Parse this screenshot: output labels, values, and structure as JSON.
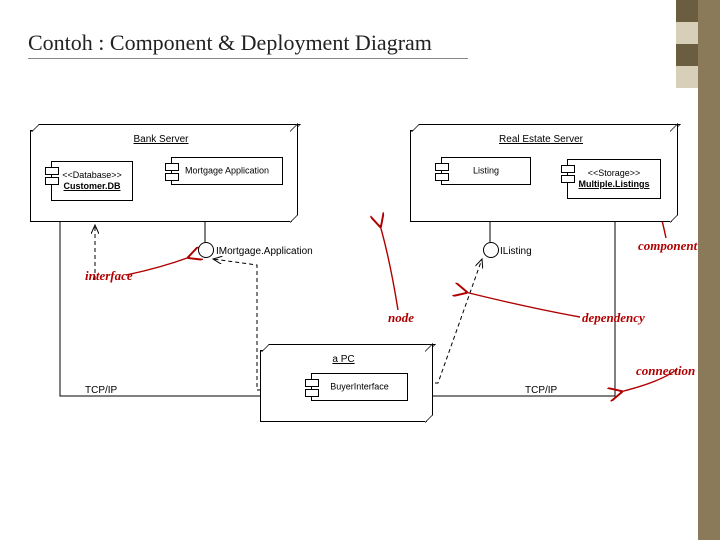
{
  "title": "Contoh : Component & Deployment Diagram",
  "nodes": {
    "bank": {
      "title": "Bank Server"
    },
    "real_estate": {
      "title": "Real Estate Server"
    },
    "pc": {
      "title": "a PC"
    }
  },
  "components": {
    "customer_db": {
      "stereotype": "<<Database>>",
      "name": "Customer.DB"
    },
    "mortgage_app": {
      "name": "Mortgage Application"
    },
    "listing": {
      "name": "Listing"
    },
    "multiple_listings": {
      "stereotype": "<<Storage>>",
      "name": "Multiple.Listings"
    },
    "buyer_interface": {
      "name": "BuyerInterface"
    }
  },
  "interfaces": {
    "mortgage": "IMortgage.Application",
    "listing": "IListing"
  },
  "connections": {
    "tcpip_left": "TCP/IP",
    "tcpip_right": "TCP/IP"
  },
  "annotations": {
    "interface": "interface",
    "node": "node",
    "component": "component",
    "dependency": "dependency",
    "connection": "connection"
  },
  "colors": {
    "annotation": "#b00000",
    "sidebar": "#8a7a5a",
    "sidebar_sq_dark": "#6b5d3f",
    "sidebar_sq_light": "#d8cfb8"
  }
}
